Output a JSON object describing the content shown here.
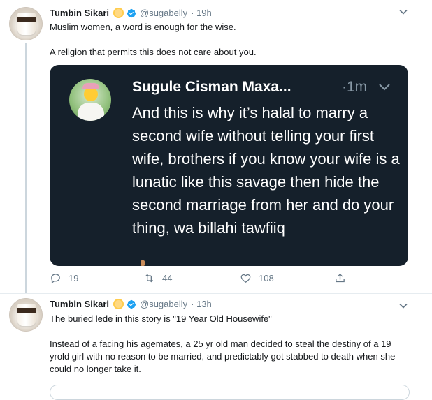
{
  "tweet1": {
    "name": "Tumbin Sikari",
    "handle": "@sugabelly",
    "time": "· 19h",
    "line1": "Muslim women, a word is enough for the wise.",
    "line2": "A religion that permits this does not care about you.",
    "card": {
      "name": "Sugule Cisman Maxa...",
      "time": "·1m",
      "text": "And this is why it’s halal to marry a second wife without telling your first wife, brothers if you know your wife is a lunatic like this savage then hide the second marriage from her and do your thing, wa billahi tawfiiq"
    },
    "actions": {
      "replies": "19",
      "retweets": "44",
      "likes": "108"
    }
  },
  "tweet2": {
    "name": "Tumbin Sikari",
    "handle": "@sugabelly",
    "time": "· 13h",
    "line1": "The buried lede in this story is \"19 Year Old Housewife\"",
    "para": "Instead of a facing his agemates, a 25 yr old man decided to steal the destiny of a 19 yrold girl with no reason to be married, and predictably got stabbed to death when she could no longer take it."
  },
  "icons": {
    "verified": "verified-badge-icon",
    "caret": "chevron-down-icon",
    "reply": "reply-icon",
    "retweet": "retweet-icon",
    "like": "heart-icon",
    "share": "share-icon"
  },
  "colors": {
    "accent": "#1da1f2",
    "card_bg": "#15202b",
    "muted": "#657786"
  }
}
